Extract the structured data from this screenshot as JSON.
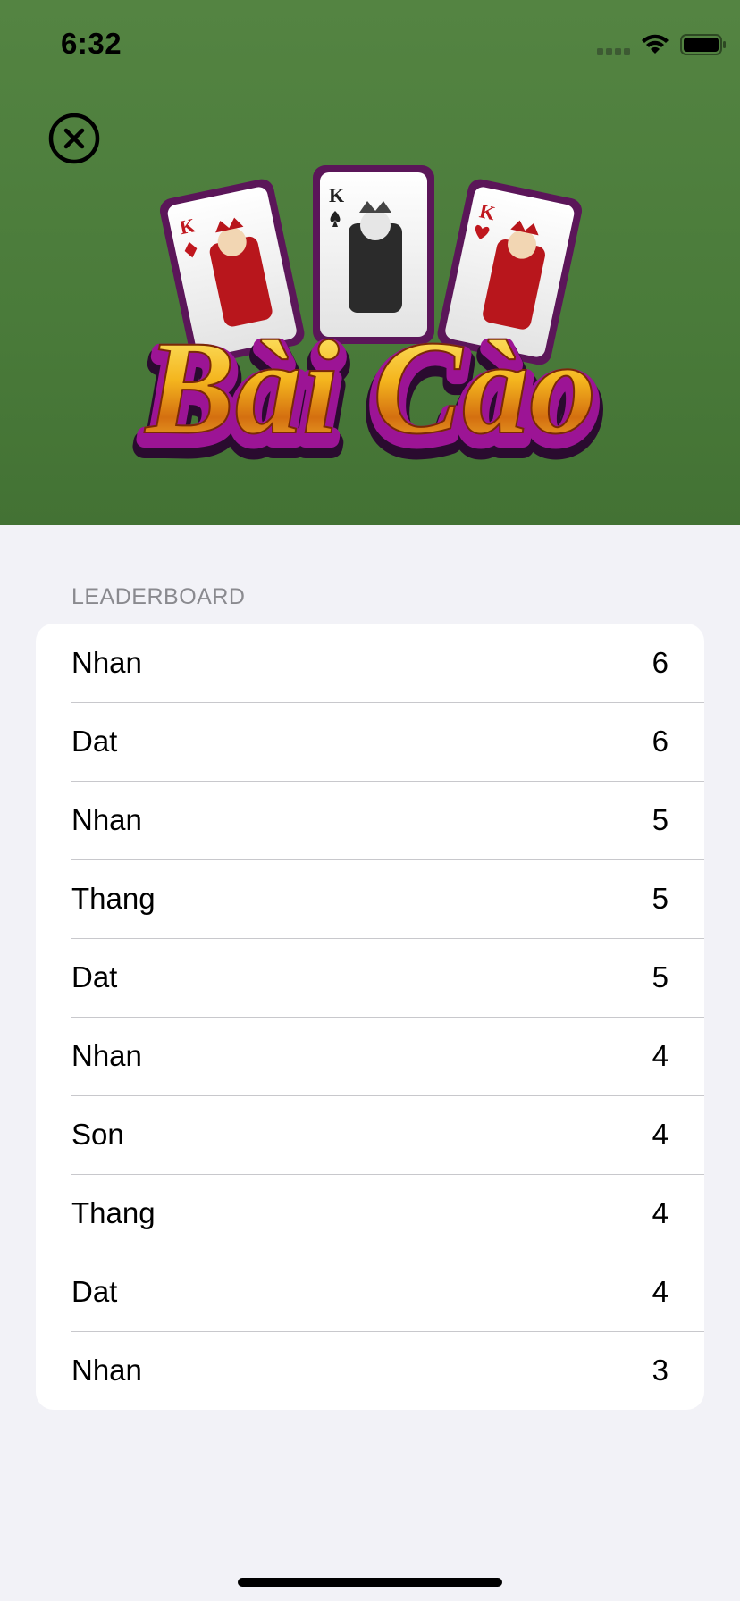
{
  "status_bar": {
    "time": "6:32",
    "icons": [
      "signal-icon",
      "wifi-icon",
      "battery-icon"
    ]
  },
  "header": {
    "close_icon": "close-icon",
    "logo_text": "Bài Cào",
    "card_ranks": [
      "K",
      "K",
      "K"
    ],
    "background_color": "#4e7f3d"
  },
  "leaderboard": {
    "section_title": "LEADERBOARD",
    "rows": [
      {
        "name": "Nhan",
        "score": "6"
      },
      {
        "name": "Dat",
        "score": "6"
      },
      {
        "name": "Nhan",
        "score": "5"
      },
      {
        "name": "Thang",
        "score": "5"
      },
      {
        "name": "Dat",
        "score": "5"
      },
      {
        "name": "Nhan",
        "score": "4"
      },
      {
        "name": "Son",
        "score": "4"
      },
      {
        "name": "Thang",
        "score": "4"
      },
      {
        "name": "Dat",
        "score": "4"
      },
      {
        "name": "Nhan",
        "score": "3"
      }
    ]
  }
}
